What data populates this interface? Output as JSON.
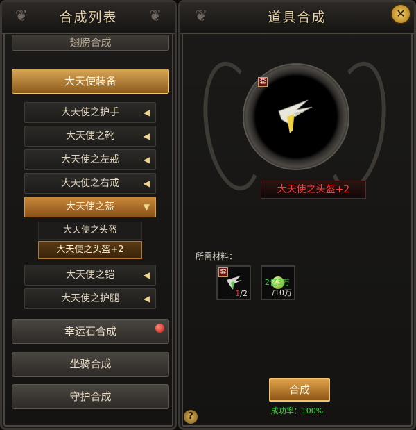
{
  "left_panel": {
    "title": "合成列表",
    "partial_top": "翅膀合成",
    "category_active": "大天使装备",
    "subcategories": [
      {
        "label": "大天使之护手"
      },
      {
        "label": "大天使之靴"
      },
      {
        "label": "大天使之左戒"
      },
      {
        "label": "大天使之右戒"
      },
      {
        "label": "大天使之盔"
      }
    ],
    "leaves": [
      {
        "label": "大天使之头盔"
      },
      {
        "label": "大天使之头盔+2"
      }
    ],
    "more_subcategories": [
      {
        "label": "大天使之铠"
      },
      {
        "label": "大天使之护腿"
      }
    ],
    "bottom_categories": [
      {
        "label": "幸运石合成"
      },
      {
        "label": "坐骑合成"
      },
      {
        "label": "守护合成"
      }
    ]
  },
  "right_panel": {
    "title": "道具合成",
    "close_icon": "✕",
    "help_icon": "?",
    "result_item": "大天使之头盔+2",
    "set_badge": "套",
    "materials_label": "所需材料：",
    "materials": [
      {
        "icon": "helmet-icon",
        "have": "1",
        "need": "/2",
        "set_badge": "套"
      },
      {
        "icon": "gold-coin-icon",
        "have": "2亿3万",
        "need": "/10万"
      }
    ],
    "craft_button": "合成",
    "success_rate": "成功率：100%"
  },
  "colors": {
    "accent_gold": "#d8a555",
    "title_text": "#e8d4a8",
    "result_red": "#ff3a3a",
    "success_green": "#3bd63b"
  }
}
